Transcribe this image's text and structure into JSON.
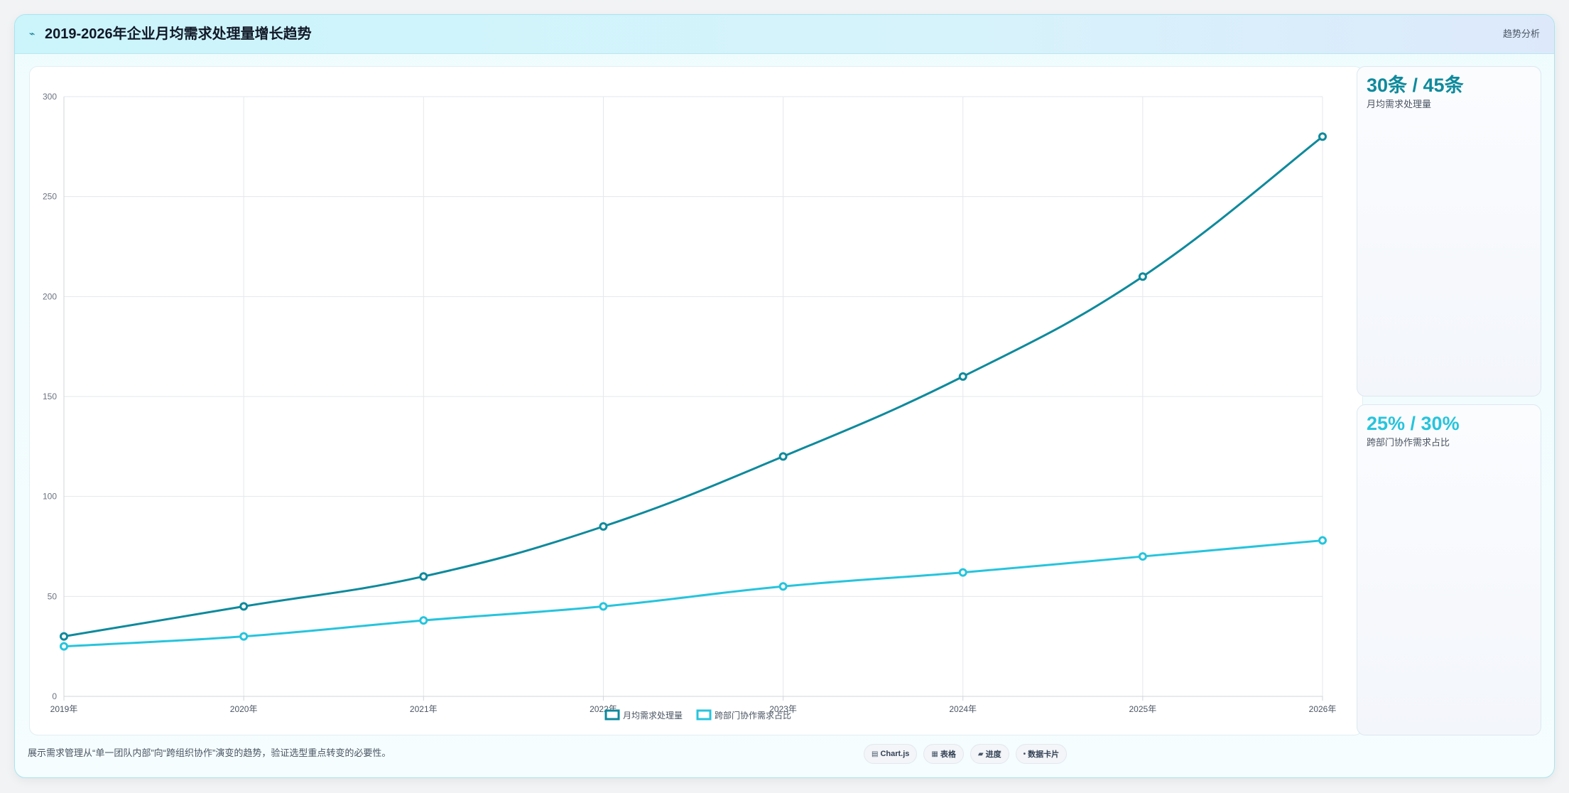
{
  "header": {
    "icon": "trend-line-icon",
    "title": "2019-2026年企业月均需求处理量增长趋势",
    "tag": "趋势分析"
  },
  "stats": [
    {
      "value": "30条 / 45条",
      "label": "月均需求处理量",
      "color": "#0e8a9c"
    },
    {
      "value": "25% / 30%",
      "label": "跨部门协作需求占比",
      "color": "#27c4dc"
    }
  ],
  "footnote": "展示需求管理从“单一团队内部”向“跨组织协作”演变的趋势，验证选型重点转变的必要性。",
  "pills": [
    {
      "icon": "chart-icon",
      "glyph": "▤",
      "label": "Chart.js"
    },
    {
      "icon": "table-icon",
      "glyph": "▦",
      "label": "表格"
    },
    {
      "icon": "progress-icon",
      "glyph": "▰",
      "label": "进度"
    },
    {
      "icon": "card-icon",
      "glyph": "•",
      "label": "数据卡片"
    }
  ],
  "chart_data": {
    "type": "line",
    "categories": [
      "2019年",
      "2020年",
      "2021年",
      "2022年",
      "2023年",
      "2024年",
      "2025年",
      "2026年"
    ],
    "series": [
      {
        "name": "月均需求处理量",
        "values": [
          30,
          45,
          60,
          85,
          120,
          160,
          210,
          280
        ],
        "color": "#0e8a9c"
      },
      {
        "name": "跨部门协作需求占比",
        "values": [
          25,
          30,
          38,
          45,
          55,
          62,
          70,
          78
        ],
        "color": "#27c4dc"
      }
    ],
    "ylim": [
      0,
      300
    ],
    "yticks": [
      0,
      50,
      100,
      150,
      200,
      250,
      300
    ],
    "grid": true,
    "legend": "bottom-center",
    "title": "",
    "xlabel": "",
    "ylabel": ""
  }
}
